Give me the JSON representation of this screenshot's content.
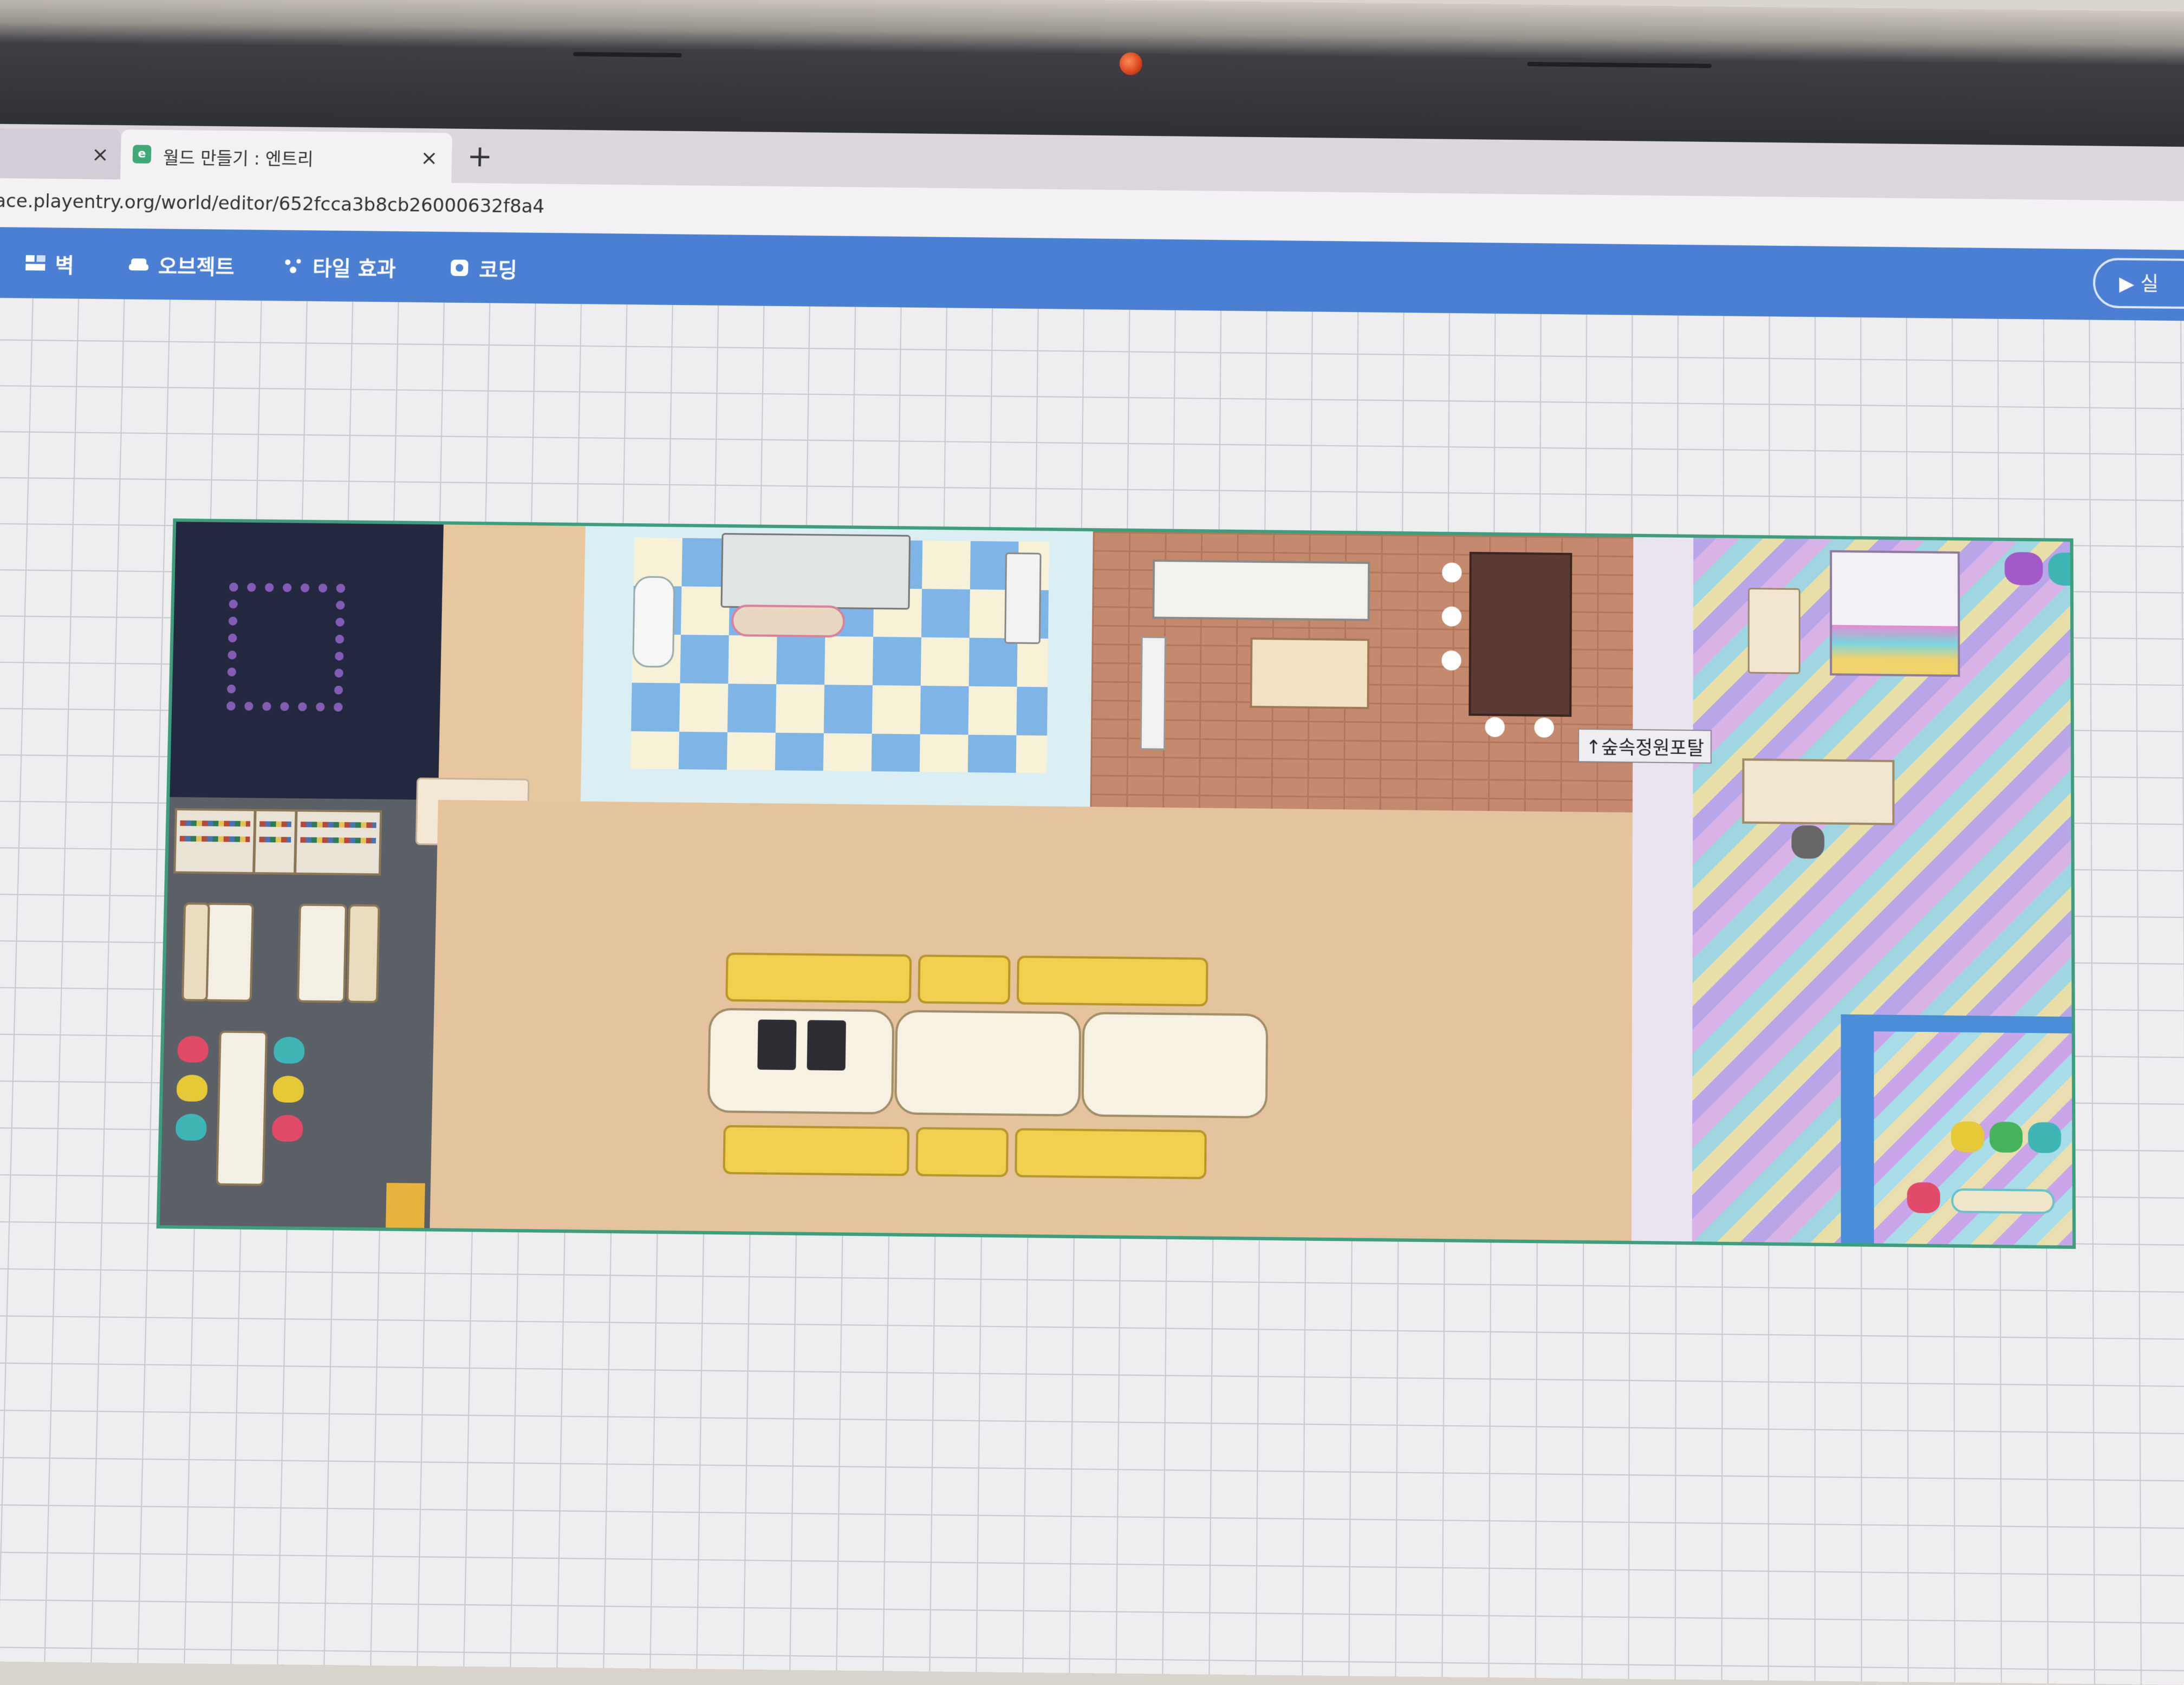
{
  "browser": {
    "previous_tab": {
      "close_glyph": "×"
    },
    "active_tab": {
      "favicon": "e",
      "title": "월드 만들기 : 엔트리",
      "close_glyph": "×"
    },
    "new_tab_glyph": "+",
    "url": "ace.playentry.org/world/editor/652fcca3b8cb26000632f8a4"
  },
  "toolbar": {
    "items": [
      {
        "label": "벽",
        "icon": "wall-icon"
      },
      {
        "label": "오브젝트",
        "icon": "sofa-icon"
      },
      {
        "label": "타일 효과",
        "icon": "sparkle-icon"
      },
      {
        "label": "코딩",
        "icon": "coding-icon"
      }
    ],
    "run_label": "▶ 실"
  },
  "map": {
    "portal_label": "↑숲속정원포탈"
  },
  "colors": {
    "toolbar": "#4a7fd4",
    "map_border": "#3d9e7e",
    "floor": "#e5c39c"
  }
}
